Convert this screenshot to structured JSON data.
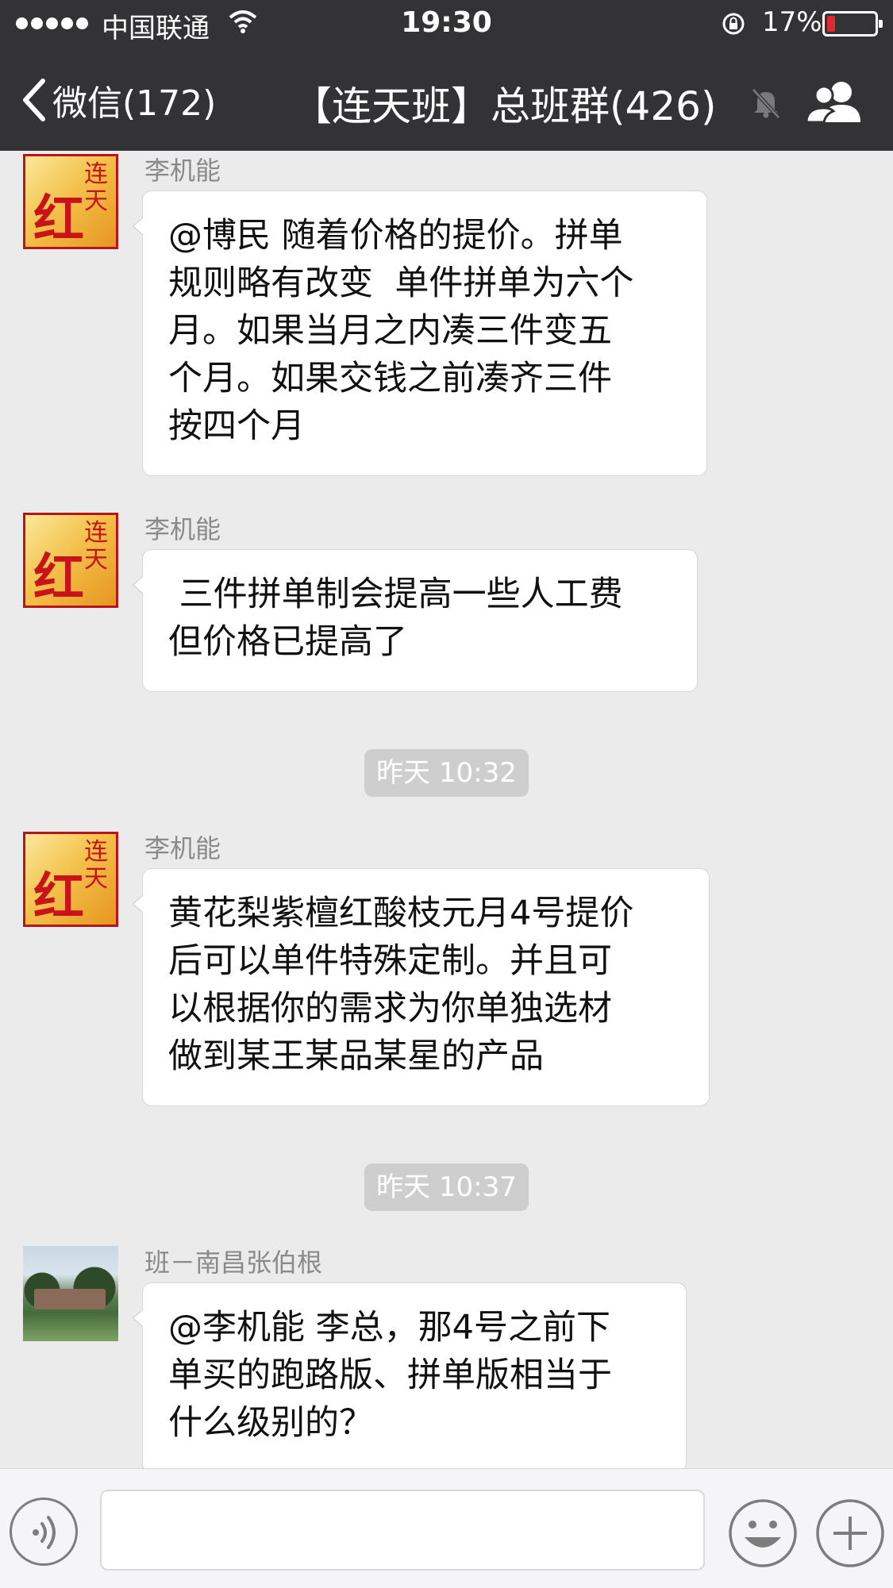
{
  "status_bar": {
    "carrier": "中国联通",
    "time": "19:30",
    "battery": "17%"
  },
  "nav": {
    "back_label": "微信(172)",
    "title": "【连天班】总班群(426)"
  },
  "avatars": {
    "hong_char_main": "红",
    "hong_char_side": "连天"
  },
  "messages": [
    {
      "sender": "李机能",
      "lines": [
        "@博民 随着价格的提价。拼单",
        "规则略有改变  单件拼单为六个",
        "月。如果当月之内凑三件变五",
        "个月。如果交钱之前凑齐三件",
        "按四个月"
      ]
    },
    {
      "sender": "李机能",
      "lines": [
        " 三件拼单制会提高一些人工费",
        "但价格已提高了"
      ]
    },
    {
      "sender": "李机能",
      "lines": [
        "黄花梨紫檀红酸枝元月4号提价",
        "后可以单件特殊定制。并且可",
        "以根据你的需求为你单独选材",
        "做到某王某品某星的产品"
      ]
    },
    {
      "sender": "班－南昌张伯根",
      "lines": [
        "@李机能 李总，那4号之前下",
        "单买的跑路版、拼单版相当于",
        "什么级别的？"
      ]
    }
  ],
  "timestamps": [
    "昨天 10:32",
    "昨天 10:37"
  ],
  "input": {
    "value": "",
    "placeholder": ""
  },
  "icons": {
    "back": "chevron-left-icon",
    "mute": "mute-bell-icon",
    "group": "group-members-icon",
    "voice": "voice-input-icon",
    "emoji": "emoji-icon",
    "plus": "plus-icon"
  },
  "colors": {
    "nav_background": "#333336",
    "chat_background": "#ebebeb",
    "bubble": "#ffffff",
    "battery_low": "#e0282e"
  }
}
